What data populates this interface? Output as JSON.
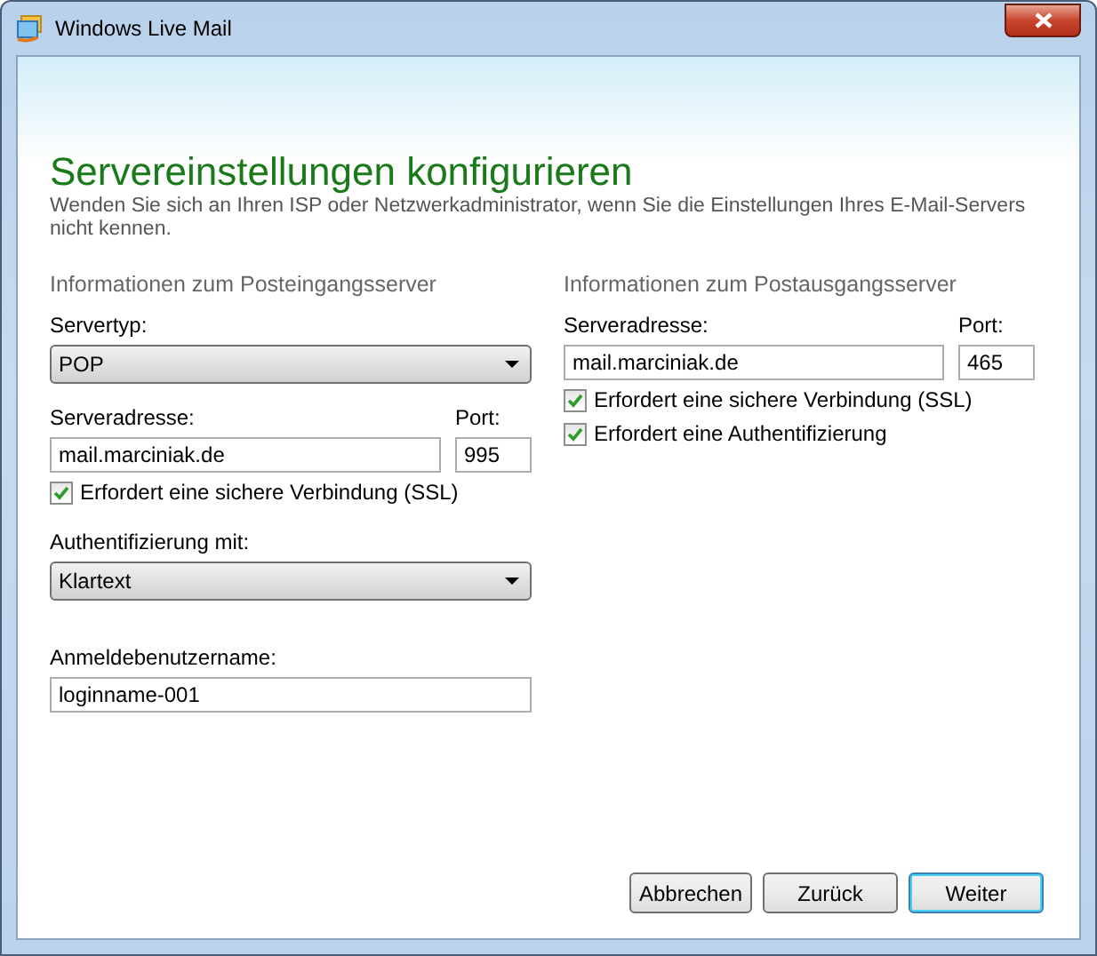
{
  "window": {
    "title": "Windows Live Mail"
  },
  "heading": "Servereinstellungen konfigurieren",
  "description": "Wenden Sie sich an Ihren ISP oder Netzwerkadministrator, wenn Sie die Einstellungen Ihres E-Mail-Servers nicht kennen.",
  "incoming": {
    "title": "Informationen zum Posteingangsserver",
    "server_type": {
      "label": "Servertyp:",
      "value": "POP"
    },
    "address": {
      "label": "Serveradresse:",
      "value": "mail.marciniak.de"
    },
    "port": {
      "label": "Port:",
      "value": "995"
    },
    "checkboxes": [
      {
        "label": "Erfordert eine sichere Verbindung (SSL)",
        "checked": true
      }
    ],
    "auth": {
      "label": "Authentifizierung mit:",
      "value": "Klartext"
    },
    "username": {
      "label": "Anmeldebenutzername:",
      "value": "loginname-001"
    }
  },
  "outgoing": {
    "title": "Informationen zum Postausgangsserver",
    "address": {
      "label": "Serveradresse:",
      "value": "mail.marciniak.de"
    },
    "port": {
      "label": "Port:",
      "value": "465"
    },
    "checkboxes": [
      {
        "label": "Erfordert eine sichere Verbindung (SSL)",
        "checked": true
      },
      {
        "label": "Erfordert eine Authentifizierung",
        "checked": true
      }
    ]
  },
  "buttons": [
    {
      "label": "Abbrechen",
      "default": false
    },
    {
      "label": "Zurück",
      "default": false
    },
    {
      "label": "Weiter",
      "default": true
    }
  ]
}
